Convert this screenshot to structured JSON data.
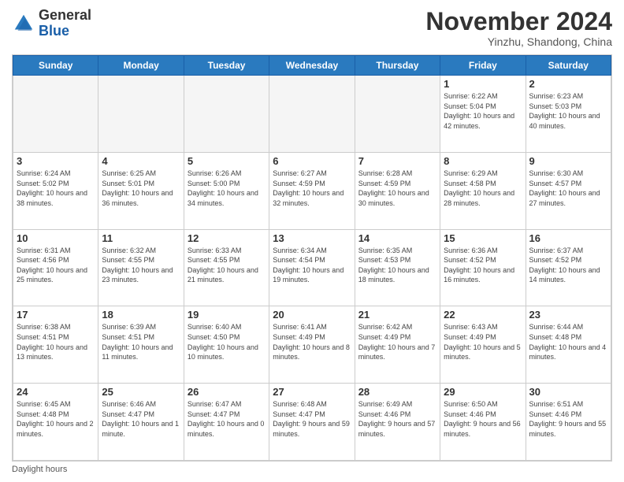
{
  "logo": {
    "line1": "General",
    "line2": "Blue"
  },
  "title": "November 2024",
  "subtitle": "Yinzhu, Shandong, China",
  "weekdays": [
    "Sunday",
    "Monday",
    "Tuesday",
    "Wednesday",
    "Thursday",
    "Friday",
    "Saturday"
  ],
  "footer": "Daylight hours",
  "weeks": [
    [
      {
        "day": "",
        "info": ""
      },
      {
        "day": "",
        "info": ""
      },
      {
        "day": "",
        "info": ""
      },
      {
        "day": "",
        "info": ""
      },
      {
        "day": "",
        "info": ""
      },
      {
        "day": "1",
        "info": "Sunrise: 6:22 AM\nSunset: 5:04 PM\nDaylight: 10 hours and 42 minutes."
      },
      {
        "day": "2",
        "info": "Sunrise: 6:23 AM\nSunset: 5:03 PM\nDaylight: 10 hours and 40 minutes."
      }
    ],
    [
      {
        "day": "3",
        "info": "Sunrise: 6:24 AM\nSunset: 5:02 PM\nDaylight: 10 hours and 38 minutes."
      },
      {
        "day": "4",
        "info": "Sunrise: 6:25 AM\nSunset: 5:01 PM\nDaylight: 10 hours and 36 minutes."
      },
      {
        "day": "5",
        "info": "Sunrise: 6:26 AM\nSunset: 5:00 PM\nDaylight: 10 hours and 34 minutes."
      },
      {
        "day": "6",
        "info": "Sunrise: 6:27 AM\nSunset: 4:59 PM\nDaylight: 10 hours and 32 minutes."
      },
      {
        "day": "7",
        "info": "Sunrise: 6:28 AM\nSunset: 4:59 PM\nDaylight: 10 hours and 30 minutes."
      },
      {
        "day": "8",
        "info": "Sunrise: 6:29 AM\nSunset: 4:58 PM\nDaylight: 10 hours and 28 minutes."
      },
      {
        "day": "9",
        "info": "Sunrise: 6:30 AM\nSunset: 4:57 PM\nDaylight: 10 hours and 27 minutes."
      }
    ],
    [
      {
        "day": "10",
        "info": "Sunrise: 6:31 AM\nSunset: 4:56 PM\nDaylight: 10 hours and 25 minutes."
      },
      {
        "day": "11",
        "info": "Sunrise: 6:32 AM\nSunset: 4:55 PM\nDaylight: 10 hours and 23 minutes."
      },
      {
        "day": "12",
        "info": "Sunrise: 6:33 AM\nSunset: 4:55 PM\nDaylight: 10 hours and 21 minutes."
      },
      {
        "day": "13",
        "info": "Sunrise: 6:34 AM\nSunset: 4:54 PM\nDaylight: 10 hours and 19 minutes."
      },
      {
        "day": "14",
        "info": "Sunrise: 6:35 AM\nSunset: 4:53 PM\nDaylight: 10 hours and 18 minutes."
      },
      {
        "day": "15",
        "info": "Sunrise: 6:36 AM\nSunset: 4:52 PM\nDaylight: 10 hours and 16 minutes."
      },
      {
        "day": "16",
        "info": "Sunrise: 6:37 AM\nSunset: 4:52 PM\nDaylight: 10 hours and 14 minutes."
      }
    ],
    [
      {
        "day": "17",
        "info": "Sunrise: 6:38 AM\nSunset: 4:51 PM\nDaylight: 10 hours and 13 minutes."
      },
      {
        "day": "18",
        "info": "Sunrise: 6:39 AM\nSunset: 4:51 PM\nDaylight: 10 hours and 11 minutes."
      },
      {
        "day": "19",
        "info": "Sunrise: 6:40 AM\nSunset: 4:50 PM\nDaylight: 10 hours and 10 minutes."
      },
      {
        "day": "20",
        "info": "Sunrise: 6:41 AM\nSunset: 4:49 PM\nDaylight: 10 hours and 8 minutes."
      },
      {
        "day": "21",
        "info": "Sunrise: 6:42 AM\nSunset: 4:49 PM\nDaylight: 10 hours and 7 minutes."
      },
      {
        "day": "22",
        "info": "Sunrise: 6:43 AM\nSunset: 4:49 PM\nDaylight: 10 hours and 5 minutes."
      },
      {
        "day": "23",
        "info": "Sunrise: 6:44 AM\nSunset: 4:48 PM\nDaylight: 10 hours and 4 minutes."
      }
    ],
    [
      {
        "day": "24",
        "info": "Sunrise: 6:45 AM\nSunset: 4:48 PM\nDaylight: 10 hours and 2 minutes."
      },
      {
        "day": "25",
        "info": "Sunrise: 6:46 AM\nSunset: 4:47 PM\nDaylight: 10 hours and 1 minute."
      },
      {
        "day": "26",
        "info": "Sunrise: 6:47 AM\nSunset: 4:47 PM\nDaylight: 10 hours and 0 minutes."
      },
      {
        "day": "27",
        "info": "Sunrise: 6:48 AM\nSunset: 4:47 PM\nDaylight: 9 hours and 59 minutes."
      },
      {
        "day": "28",
        "info": "Sunrise: 6:49 AM\nSunset: 4:46 PM\nDaylight: 9 hours and 57 minutes."
      },
      {
        "day": "29",
        "info": "Sunrise: 6:50 AM\nSunset: 4:46 PM\nDaylight: 9 hours and 56 minutes."
      },
      {
        "day": "30",
        "info": "Sunrise: 6:51 AM\nSunset: 4:46 PM\nDaylight: 9 hours and 55 minutes."
      }
    ]
  ]
}
